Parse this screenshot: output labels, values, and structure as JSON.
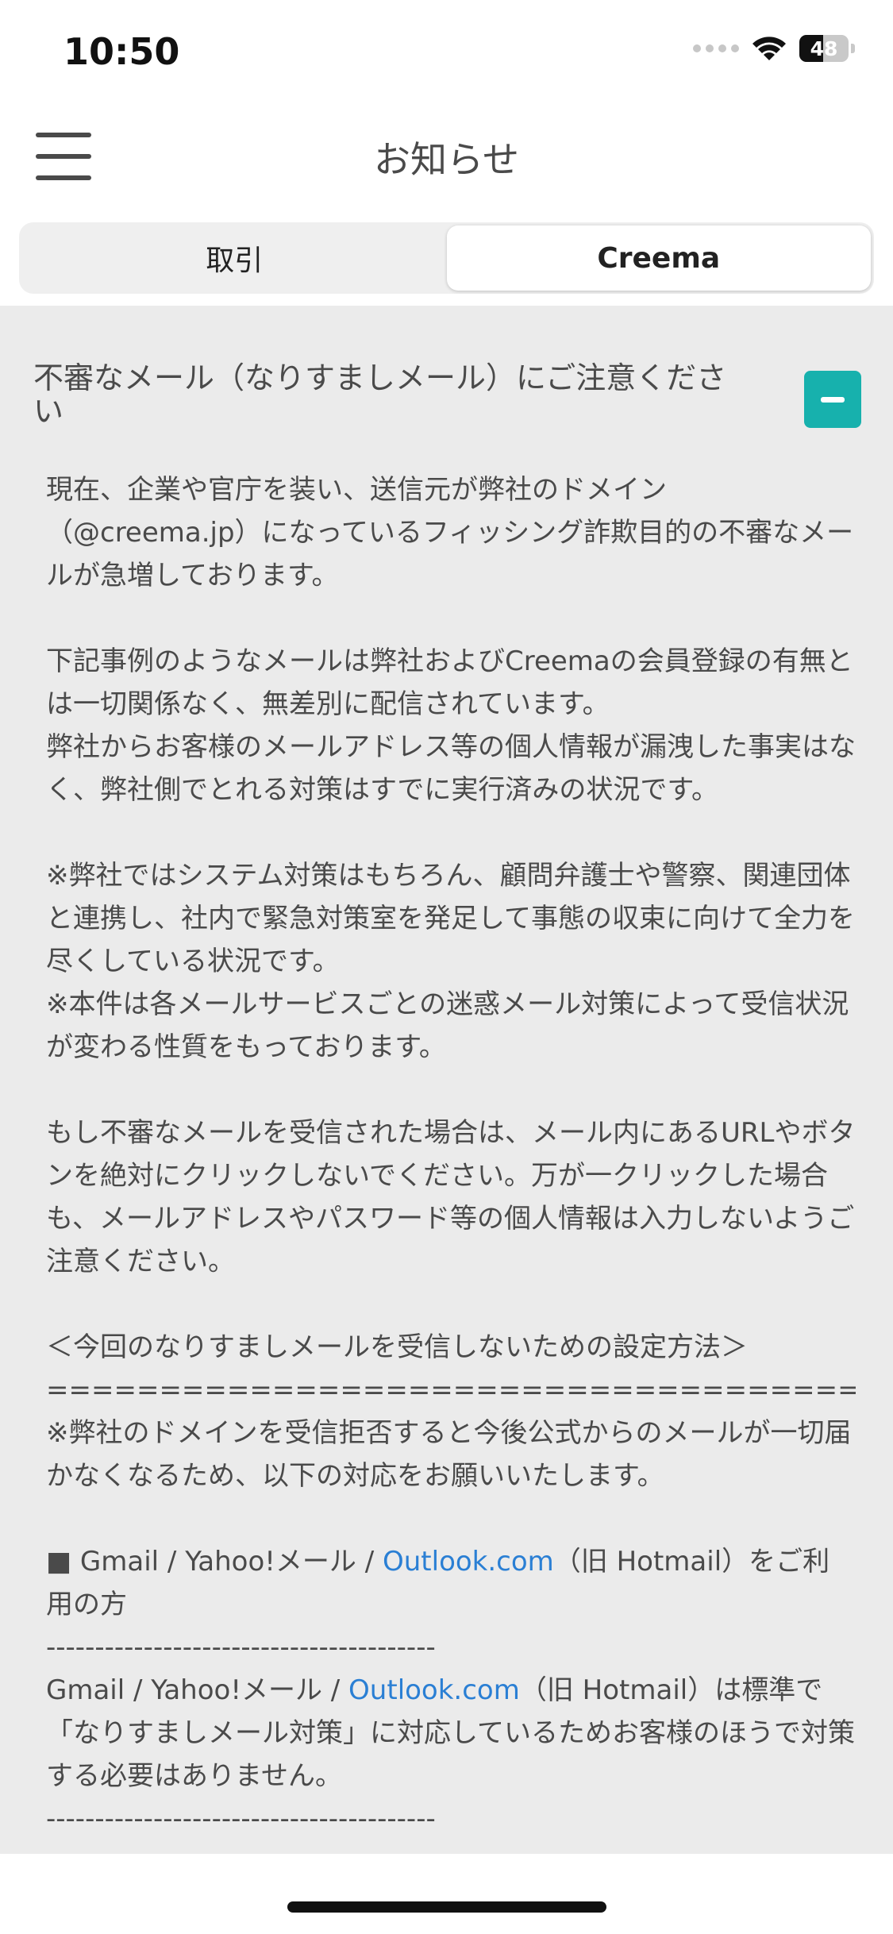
{
  "status_bar": {
    "time": "10:50",
    "battery": "48",
    "battery_level": 0.48
  },
  "header": {
    "title": "お知らせ"
  },
  "tabs": [
    {
      "label": "取引",
      "active": false
    },
    {
      "label": "Creema",
      "active": true
    }
  ],
  "notice": {
    "title": "不審なメール（なりすましメール）にご注意ください",
    "body": {
      "p1": "現在、企業や官庁を装い、送信元が弊社のドメイン（@creema.jp）になっているフィッシング詐欺目的の不審なメールが急増しております。",
      "p2a": "下記事例のようなメールは弊社およびCreemaの会員登録の有無とは一切関係なく、無差別に配信されています。",
      "p2b": "弊社からお客様のメールアドレス等の個人情報が漏洩した事実はなく、弊社側でとれる対策はすでに実行済みの状況です。",
      "p3a": "※弊社ではシステム対策はもちろん、顧問弁護士や警察、関連団体と連携し、社内で緊急対策室を発足して事態の収束に向けて全力を尽くしている状況です。",
      "p3b": "※本件は各メールサービスごとの迷惑メール対策によって受信状況が変わる性質をもっております。",
      "p4": "もし不審なメールを受信された場合は、メール内にあるURLやボタンを絶対にクリックしないでください。万が一クリックした場合も、メールアドレスやパスワード等の個人情報は入力しないようご注意ください。",
      "p5_heading": "＜今回のなりすましメールを受信しないための設定方法＞",
      "p5_rule": "====================================",
      "p5_text": "※弊社のドメインを受信拒否すると今後公式からのメールが一切届かなくなるため、以下の対応をお願いいたします。",
      "p6_prefix": "■ Gmail / Yahoo!メール / ",
      "p6_link": "Outlook.com",
      "p6_suffix": "（旧 Hotmail）をご利用の方",
      "p6_rule": "----------------------------------------",
      "p7_prefix": "Gmail / Yahoo!メール / ",
      "p7_link": "Outlook.com",
      "p7_suffix": "（旧 Hotmail）は標準で「なりすましメール対策」に対応しているためお客様のほうで対策する必要はありません。",
      "p7_rule": "----------------------------------------"
    }
  },
  "colors": {
    "accent": "#17b1ad",
    "link": "#2a7fd4",
    "content_bg": "#ebebeb"
  },
  "icons": {
    "menu": "hamburger-menu-icon",
    "collapse": "minus-icon",
    "wifi": "wifi-icon",
    "signal": "cellular-signal-icon",
    "battery": "battery-icon"
  }
}
